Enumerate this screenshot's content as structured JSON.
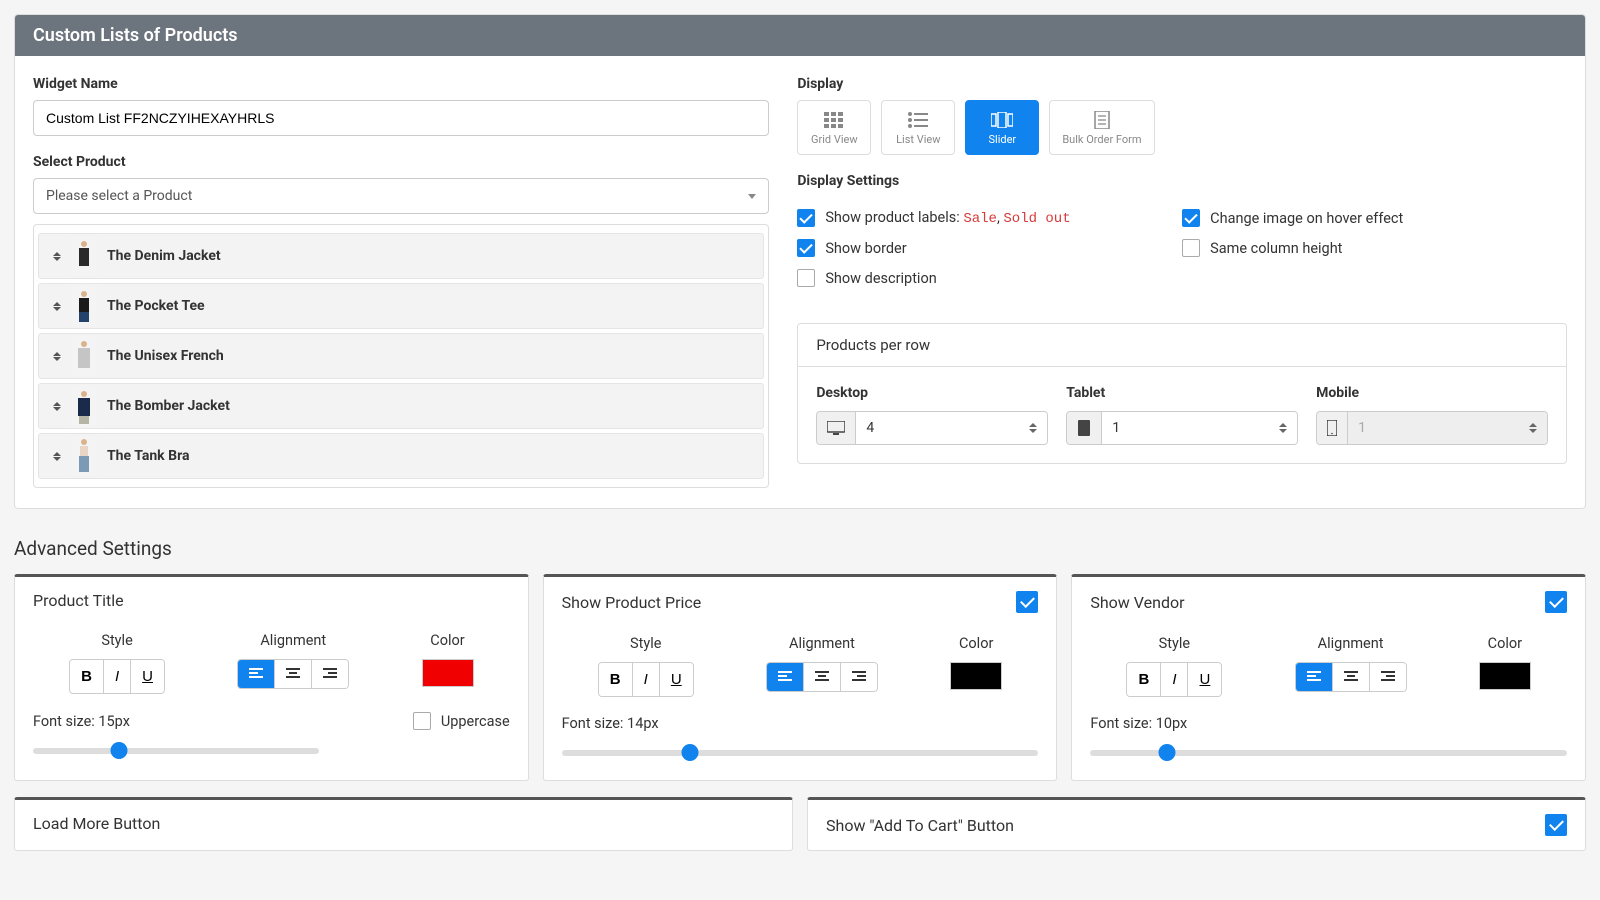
{
  "header": {
    "title": "Custom Lists of Products"
  },
  "widget_name": {
    "label": "Widget Name",
    "value": "Custom List FF2NCZYIHEXAYHRLS"
  },
  "select_product": {
    "label": "Select Product",
    "placeholder": "Please select a Product"
  },
  "products": [
    {
      "name": "The Denim Jacket"
    },
    {
      "name": "The Pocket Tee"
    },
    {
      "name": "The Unisex French"
    },
    {
      "name": "The Bomber Jacket"
    },
    {
      "name": "The Tank Bra"
    }
  ],
  "display": {
    "label": "Display",
    "options": [
      {
        "id": "grid",
        "label": "Grid View"
      },
      {
        "id": "list",
        "label": "List View"
      },
      {
        "id": "slider",
        "label": "Slider",
        "active": true
      },
      {
        "id": "bulk",
        "label": "Bulk Order Form"
      }
    ]
  },
  "display_settings": {
    "label": "Display Settings",
    "show_labels": {
      "text_prefix": "Show product labels: ",
      "sale": "Sale",
      "sep": ", ",
      "soldout": "Sold out",
      "checked": true
    },
    "hover": {
      "text": "Change image on hover effect",
      "checked": true
    },
    "border": {
      "text": "Show border",
      "checked": true
    },
    "same_col": {
      "text": "Same column height",
      "checked": false
    },
    "desc": {
      "text": "Show description",
      "checked": false
    }
  },
  "products_per_row": {
    "title": "Products per row",
    "desktop": {
      "label": "Desktop",
      "value": "4"
    },
    "tablet": {
      "label": "Tablet",
      "value": "1"
    },
    "mobile": {
      "label": "Mobile",
      "value": "1",
      "disabled": true
    }
  },
  "advanced": {
    "title": "Advanced Settings",
    "product_title": {
      "title": "Product Title",
      "style_label": "Style",
      "align_label": "Alignment",
      "color_label": "Color",
      "color": "#f00000",
      "font_label": "Font size: 15px",
      "font_pos": 30,
      "uppercase_label": "Uppercase"
    },
    "product_price": {
      "title": "Show Product Price",
      "style_label": "Style",
      "align_label": "Alignment",
      "color_label": "Color",
      "color": "#000000",
      "font_label": "Font size: 14px",
      "font_pos": 27
    },
    "vendor": {
      "title": "Show Vendor",
      "style_label": "Style",
      "align_label": "Alignment",
      "color_label": "Color",
      "color": "#000000",
      "font_label": "Font size: 10px",
      "font_pos": 16
    },
    "load_more": {
      "title": "Load More Button"
    },
    "add_to_cart": {
      "title": "Show \"Add To Cart\" Button"
    }
  }
}
